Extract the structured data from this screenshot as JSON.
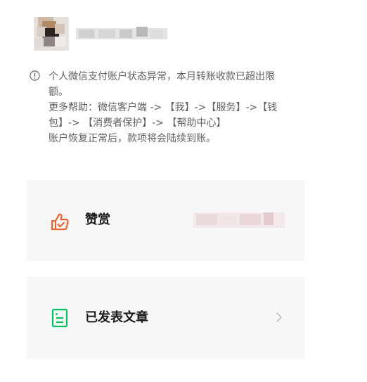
{
  "header": {
    "avatar_icon": "avatar",
    "profile_name": ""
  },
  "notice": {
    "icon": "info-circle-icon",
    "lines": [
      "个人微信支付账户状态异常，本月转账收款已超出限",
      "额。",
      "更多帮助：微信客户端 -> 【我】->【服务】->【钱",
      "包】-> 【消费者保护】-> 【帮助中心】",
      "账户恢复正常后，款项将会陆续到账。"
    ]
  },
  "rows": {
    "reward": {
      "icon": "thumbs-up-icon",
      "label": "赞赏",
      "value": ""
    },
    "articles": {
      "icon": "document-icon",
      "label": "已发表文章",
      "chevron": "chevron-right-icon"
    }
  },
  "colors": {
    "reward_icon": "#f0602e",
    "article_icon": "#07c160",
    "card_background": "#f7f7f7",
    "notice_text": "#5f5f5f"
  }
}
